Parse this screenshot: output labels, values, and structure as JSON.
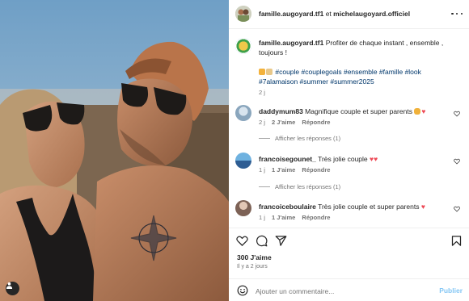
{
  "post": {
    "author": "famille.augoyard.tf1",
    "separator": "et",
    "collaborator": "michelaugoyard.officiel",
    "caption_text": "Profiter de chaque instant , ensemble , toujours !",
    "hashtags": "#couple #couplegoals #ensemble #famille #look #7alamaison #summer #summer2025",
    "caption_age": "2 j"
  },
  "comments": [
    {
      "username": "daddymum83",
      "text": "Magnifique couple et super parents",
      "age": "2 j",
      "likes": "2 J'aime",
      "reply": "Répondre",
      "view_replies": "Afficher les réponses (1)",
      "avatar_color": "#9ab3c9"
    },
    {
      "username": "francoisegounet_",
      "text": "Très jolie couple",
      "age": "1 j",
      "likes": "1 J'aime",
      "reply": "Répondre",
      "view_replies": "Afficher les réponses (1)",
      "avatar_color": "#3e6fa8"
    },
    {
      "username": "francoiceboulaire",
      "text": "Très jolie couple et super parents",
      "age": "1 j",
      "likes": "1 J'aime",
      "reply": "Répondre",
      "view_replies": "",
      "avatar_color": "#a68a7a"
    }
  ],
  "actions": {
    "likes_count": "300 J'aime",
    "posted_ago": "Il y a 2 jours",
    "comment_placeholder": "Ajouter un commentaire...",
    "post_label": "Publier"
  },
  "colors": {
    "hashtag": "#00376b",
    "heart": "#ed4956",
    "publish_disabled": "#85c7f5"
  }
}
